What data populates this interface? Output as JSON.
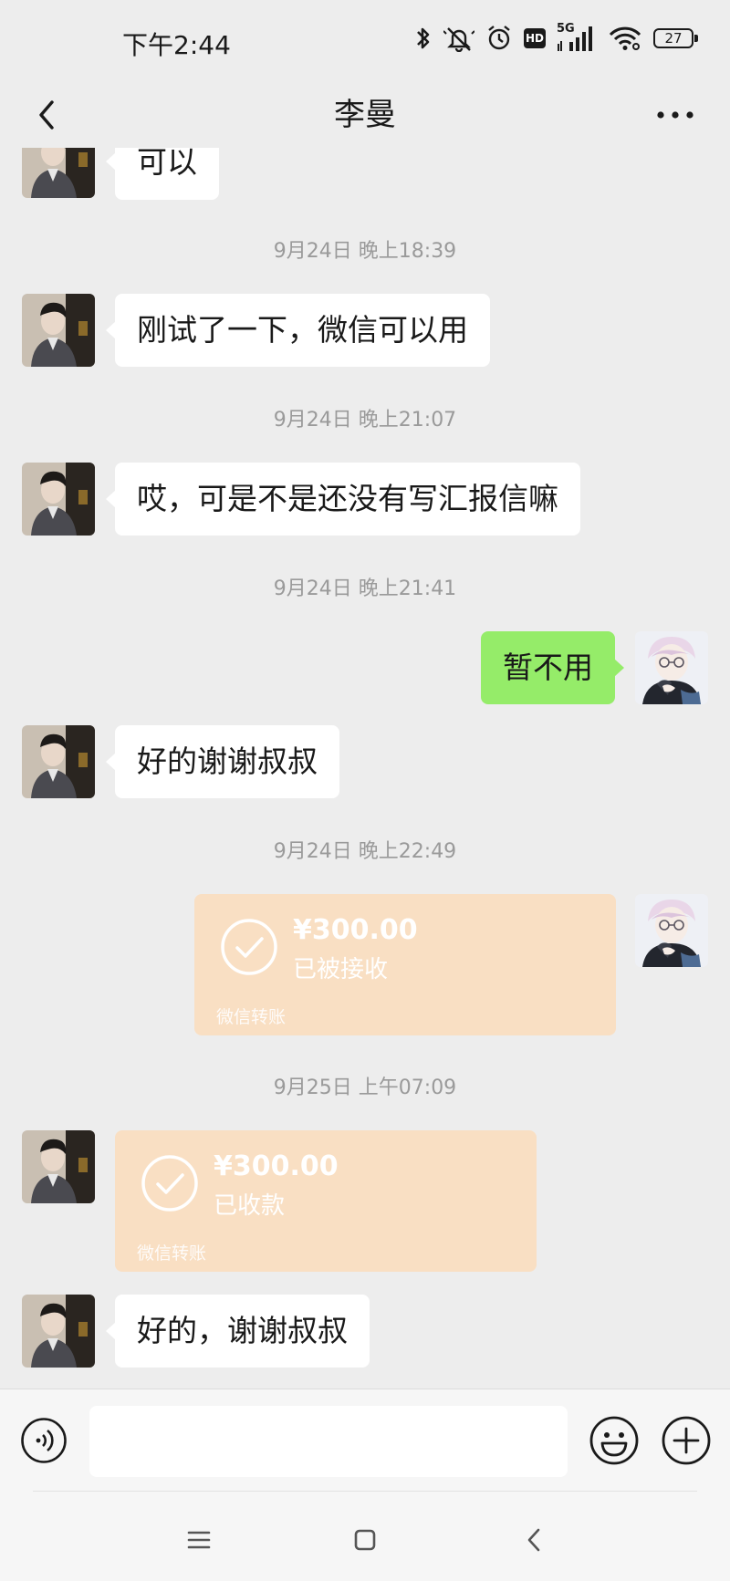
{
  "status_bar": {
    "time": "下午2:44",
    "network": "5G",
    "hd": "HD",
    "battery": "27",
    "icons": [
      "bluetooth-icon",
      "mute-icon",
      "alarm-icon",
      "hd-icon",
      "signal-icon",
      "wifi-icon",
      "battery-icon"
    ]
  },
  "header": {
    "title": "李曼",
    "back_icon": "chevron-left-icon",
    "more_icon": "more-dots-icon"
  },
  "messages": [
    {
      "type": "text",
      "side": "left",
      "text": "可以"
    },
    {
      "type": "time",
      "text": "9月24日 晚上18:39"
    },
    {
      "type": "text",
      "side": "left",
      "text": "刚试了一下，微信可以用"
    },
    {
      "type": "time",
      "text": "9月24日 晚上21:07"
    },
    {
      "type": "text",
      "side": "left",
      "text": "哎，可是不是还没有写汇报信嘛"
    },
    {
      "type": "time",
      "text": "9月24日 晚上21:41"
    },
    {
      "type": "text",
      "side": "right",
      "text": "暂不用"
    },
    {
      "type": "text",
      "side": "left",
      "text": "好的谢谢叔叔"
    },
    {
      "type": "time",
      "text": "9月24日 晚上22:49"
    },
    {
      "type": "transfer",
      "side": "right",
      "amount": "¥300.00",
      "status": "已被接收",
      "label": "微信转账"
    },
    {
      "type": "time",
      "text": "9月25日 上午07:09"
    },
    {
      "type": "transfer",
      "side": "left",
      "amount": "¥300.00",
      "status": "已收款",
      "label": "微信转账"
    },
    {
      "type": "text",
      "side": "left",
      "text": "好的，谢谢叔叔"
    }
  ],
  "input_bar": {
    "value": "",
    "icons": [
      "voice-icon",
      "emoji-icon",
      "plus-icon"
    ]
  },
  "system_nav": {
    "icons": [
      "menu-icon",
      "home-icon",
      "back-icon"
    ]
  },
  "colors": {
    "background": "#ededed",
    "bubble_left": "#ffffff",
    "bubble_right": "#95ec69",
    "transfer_card": "#f9dfc3",
    "timestamp": "#9a9a9a"
  }
}
